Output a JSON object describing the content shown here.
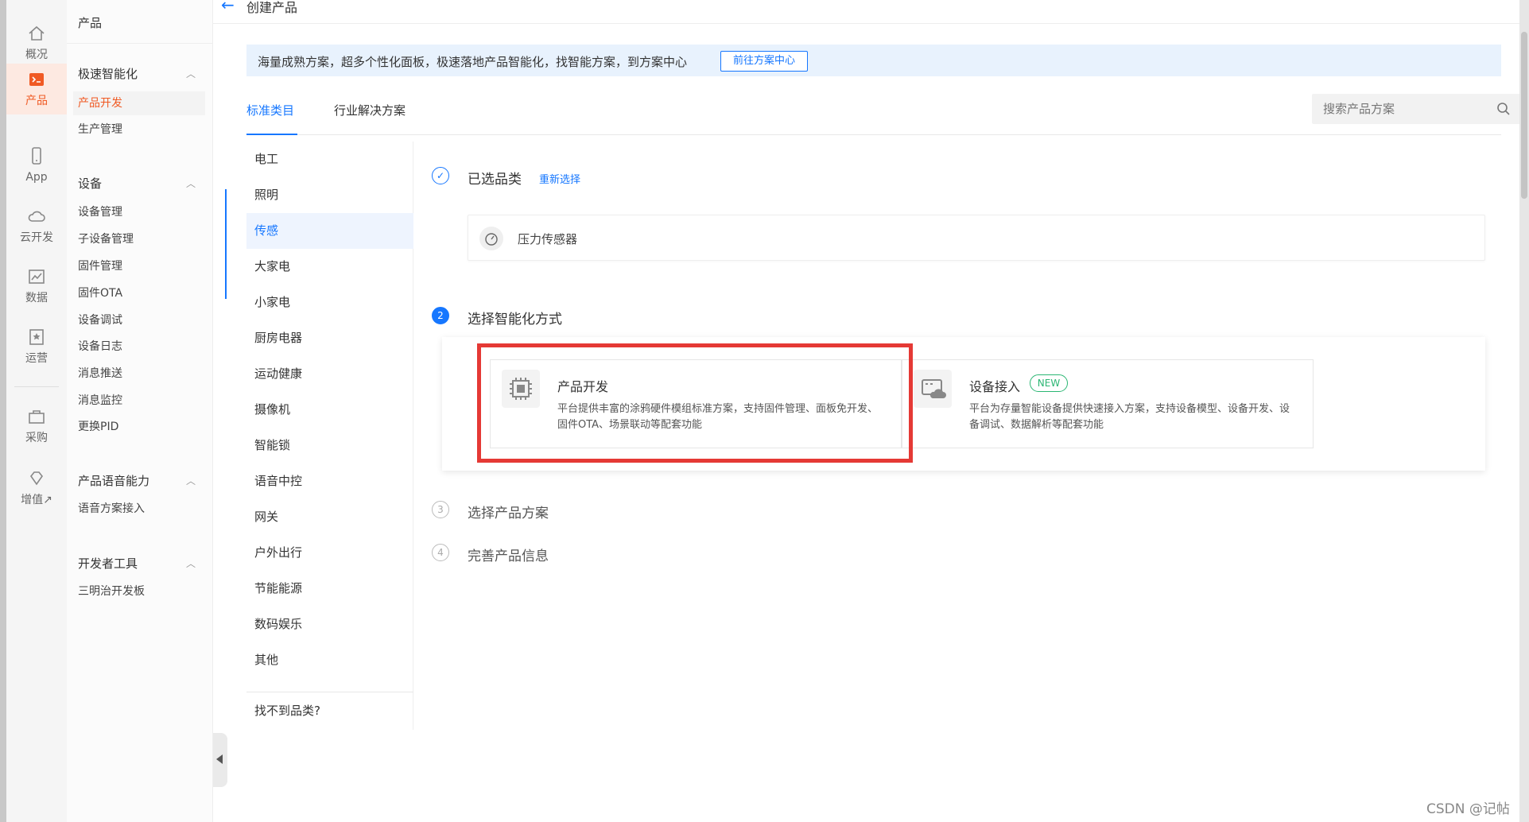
{
  "rail": {
    "items": [
      {
        "label": "概况",
        "icon": "home-icon"
      },
      {
        "label": "产品",
        "icon": "terminal-icon",
        "active": true
      },
      {
        "label": "App",
        "icon": "phone-icon"
      },
      {
        "label": "云开发",
        "icon": "cloud-icon"
      },
      {
        "label": "数据",
        "icon": "chart-icon"
      },
      {
        "label": "运营",
        "icon": "badge-icon"
      },
      {
        "label": "采购",
        "icon": "cart-icon"
      },
      {
        "label": "增值↗",
        "icon": "diamond-icon"
      }
    ],
    "accent": "#f05a24"
  },
  "subnav": {
    "head": "产品",
    "groups": [
      {
        "title": "极速智能化",
        "items": [
          "产品开发",
          "生产管理"
        ]
      },
      {
        "title": "设备",
        "items": [
          "设备管理",
          "子设备管理",
          "固件管理",
          "固件OTA",
          "设备调试",
          "设备日志",
          "消息推送",
          "消息监控",
          "更换PID"
        ]
      },
      {
        "title": "产品语音能力",
        "items": [
          "语音方案接入"
        ]
      },
      {
        "title": "开发者工具",
        "items": [
          "三明治开发板"
        ]
      }
    ],
    "active_item": "产品开发"
  },
  "header": {
    "title": "创建产品"
  },
  "banner": {
    "text": "海量成熟方案，超多个性化面板，极速落地产品智能化，找智能方案，到方案中心",
    "button": "前往方案中心"
  },
  "tabs": {
    "items": [
      "标准类目",
      "行业解决方案"
    ],
    "active": "标准类目",
    "search_placeholder": "搜索产品方案"
  },
  "categories": {
    "items": [
      "电工",
      "照明",
      "传感",
      "大家电",
      "小家电",
      "厨房电器",
      "运动健康",
      "摄像机",
      "智能锁",
      "语音中控",
      "网关",
      "户外出行",
      "节能能源",
      "数码娱乐",
      "其他"
    ],
    "active": "传感",
    "footer": "找不到品类?"
  },
  "steps": {
    "s1": {
      "num": "✓",
      "title": "已选品类",
      "link": "重新选择",
      "selected": "压力传感器"
    },
    "s2": {
      "num": "2",
      "title": "选择智能化方式"
    },
    "s3": {
      "num": "3",
      "title": "选择产品方案"
    },
    "s4": {
      "num": "4",
      "title": "完善产品信息"
    }
  },
  "options": [
    {
      "title": "产品开发",
      "desc": "平台提供丰富的涂鸦硬件模组标准方案，支持固件管理、面板免开发、固件OTA、场景联动等配套功能",
      "icon": "chip-icon"
    },
    {
      "title": "设备接入",
      "badge": "NEW",
      "desc": "平台为存量智能设备提供快速接入方案，支持设备模型、设备开发、设备调试、数据解析等配套功能",
      "icon": "cloud-device-icon"
    }
  ],
  "colors": {
    "primary": "#1677ff",
    "highlight_box": "#e53935",
    "badge": "#2bb673"
  },
  "watermark": "CSDN @记帖"
}
